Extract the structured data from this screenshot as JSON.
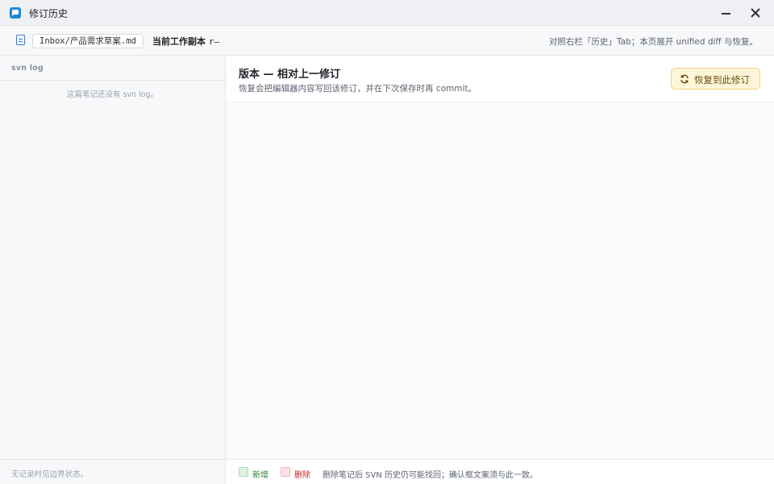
{
  "window": {
    "title": "修订历史",
    "icon": "app-chat-icon",
    "controls": {
      "minimize": "minimize-icon",
      "close": "close-icon"
    }
  },
  "toolbar": {
    "file_icon": "document-icon",
    "file_path": "Inbox/产品需求草案.md",
    "working_copy_label": "当前工作副本",
    "working_copy_rev": "r—",
    "hint": "对照右栏「历史」Tab；本页展开 unified diff 与恢复。"
  },
  "sidebar": {
    "header": "svn log",
    "empty_text": "这篇笔记还没有 svn log。",
    "footer": "无记录时见边界状态。"
  },
  "main": {
    "title": "版本 — 相对上一修订",
    "subtitle": "恢复会把编辑器内容写回该修订，并在下次保存时再 commit。",
    "restore_button": "恢复到此修订",
    "restore_icon": "refresh-icon"
  },
  "legend": {
    "added": "新增",
    "deleted": "删除",
    "note": "删除笔记后 SVN 历史仍可能找回；确认框文案须与此一致。"
  },
  "colors": {
    "accent": "#1e88d6",
    "restore_bg": "#fff6da",
    "restore_border": "#f0d27a",
    "added": "#2e7d32",
    "deleted": "#c62828"
  }
}
